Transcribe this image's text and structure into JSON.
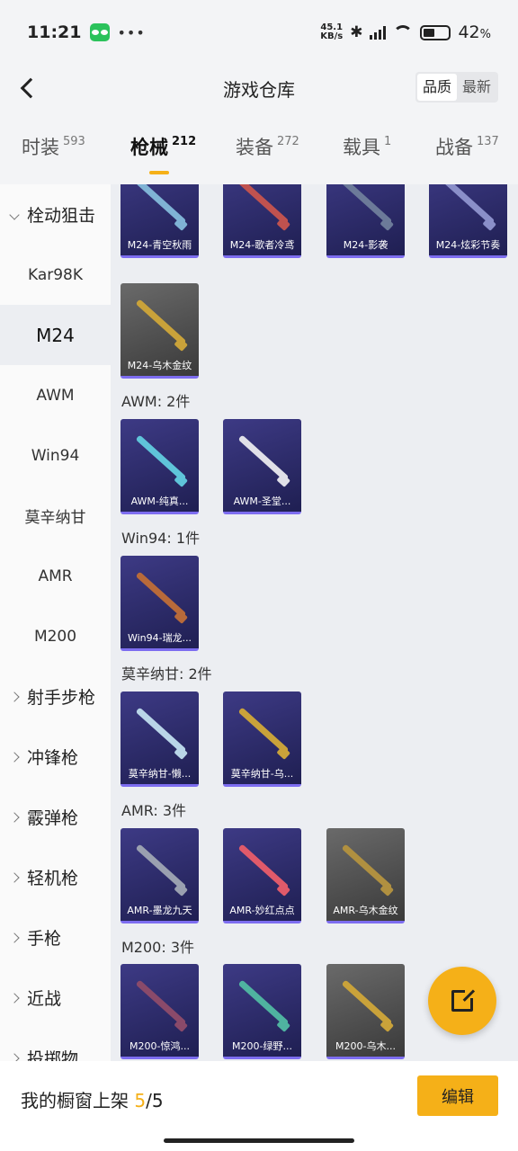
{
  "status": {
    "time": "11:21",
    "netspeed_value": "45.1",
    "netspeed_unit": "KB/s",
    "battery": "42",
    "battery_unit": "%"
  },
  "header": {
    "title": "游戏仓库",
    "sort_quality": "品质",
    "sort_latest": "最新"
  },
  "tabs": [
    {
      "label": "时装",
      "count": "593"
    },
    {
      "label": "枪械",
      "count": "212"
    },
    {
      "label": "装备",
      "count": "272"
    },
    {
      "label": "载具",
      "count": "1"
    },
    {
      "label": "战备",
      "count": "137"
    }
  ],
  "sidebar": {
    "items": [
      {
        "label": "栓动狙击"
      },
      {
        "label": "Kar98K"
      },
      {
        "label": "M24"
      },
      {
        "label": "AWM"
      },
      {
        "label": "Win94"
      },
      {
        "label": "莫辛纳甘"
      },
      {
        "label": "AMR"
      },
      {
        "label": "M200"
      },
      {
        "label": "射手步枪"
      },
      {
        "label": "冲锋枪"
      },
      {
        "label": "霰弹枪"
      },
      {
        "label": "轻机枪"
      },
      {
        "label": "手枪"
      },
      {
        "label": "近战"
      },
      {
        "label": "投掷物"
      }
    ]
  },
  "sections": [
    {
      "label": "AWM: 2件"
    },
    {
      "label": "Win94: 1件"
    },
    {
      "label": "莫辛纳甘: 2件"
    },
    {
      "label": "AMR: 3件"
    },
    {
      "label": "M200: 3件"
    }
  ],
  "cards": [
    {
      "name": "M24-青空秋雨",
      "gun_color": "#7fb3d5"
    },
    {
      "name": "M24-歌者冷鸢",
      "gun_color": "#c0524f"
    },
    {
      "name": "M24-影袭",
      "gun_color": "#6c7a99"
    },
    {
      "name": "M24-炫彩节奏",
      "gun_color": "#8a8fc9"
    },
    {
      "name": "M24-乌木金纹",
      "gun_color": "#c9a23a"
    },
    {
      "name": "AWM-纯真...",
      "gun_color": "#5fc4d9"
    },
    {
      "name": "AWM-圣堂...",
      "gun_color": "#e0e0e8"
    },
    {
      "name": "Win94-瑞龙...",
      "gun_color": "#b86a3a"
    },
    {
      "name": "莫辛纳甘-懒...",
      "gun_color": "#b9d5e8"
    },
    {
      "name": "莫辛纳甘-乌...",
      "gun_color": "#c9a23a"
    },
    {
      "name": "AMR-墨龙九天",
      "gun_color": "#9aa0b0"
    },
    {
      "name": "AMR-妙红点点",
      "gun_color": "#e05a6a"
    },
    {
      "name": "AMR-乌木金纹",
      "gun_color": "#b09040"
    },
    {
      "name": "M200-惊鸿...",
      "gun_color": "#8a4a6a"
    },
    {
      "name": "M200-绿野...",
      "gun_color": "#4fb3a0"
    },
    {
      "name": "M200-乌木...",
      "gun_color": "#c9a23a"
    }
  ],
  "bottom": {
    "showcase_label": "我的橱窗上架 ",
    "showcase_current": "5",
    "showcase_total": "/5",
    "edit_label": "编辑"
  },
  "colors": {
    "accent": "#f5b018",
    "card_purple": "#2e2c6e",
    "card_gray": "#555555"
  },
  "icons": [
    "back-arrow-icon",
    "wechat-icon",
    "bluetooth-icon",
    "wifi-icon",
    "battery-icon",
    "chevron-down-icon",
    "chevron-right-icon",
    "share-external-icon"
  ]
}
